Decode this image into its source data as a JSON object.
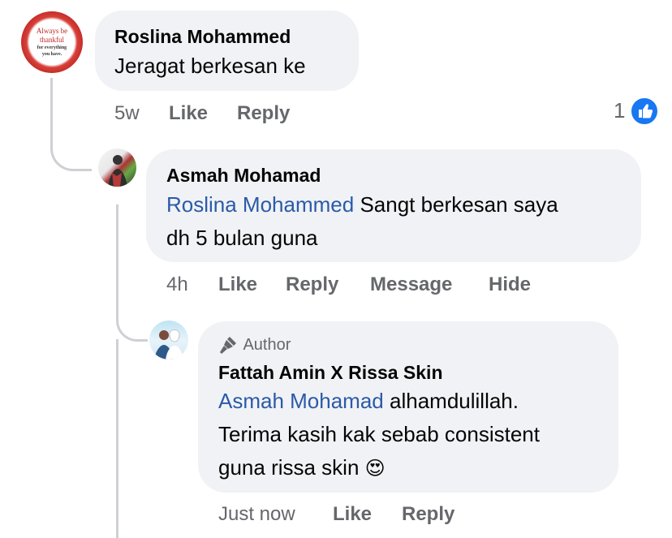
{
  "comments": [
    {
      "author": "Roslina Mohammed",
      "text": "Jeragat berkesan ke",
      "time": "5w",
      "actions": [
        "Like",
        "Reply"
      ],
      "reaction_count": "1",
      "avatar_text": {
        "line1": "Always be",
        "line2": "thankful",
        "line3": "for everything",
        "line4": "you have."
      }
    },
    {
      "author": "Asmah Mohamad",
      "mention": "Roslina Mohammed",
      "text_line1": "Sangt berkesan saya",
      "text_line2": "dh 5 bulan guna",
      "time": "4h",
      "actions": [
        "Like",
        "Reply",
        "Message",
        "Hide"
      ]
    },
    {
      "badge": "Author",
      "author": "Fattah Amin X Rissa Skin",
      "mention": "Asmah Mohamad",
      "text_line1": "alhamdulillah.",
      "text_line2": "Terima kasih kak sebab consistent",
      "text_line3": "guna rissa skin",
      "emoji": "😍",
      "time": "Just now",
      "actions": [
        "Like",
        "Reply"
      ]
    }
  ],
  "colors": {
    "bubble": "#f0f2f5",
    "mention": "#2b5aa8",
    "like_badge": "#1877f2",
    "meta_text": "#65676b",
    "thread_line": "#ced0d4"
  }
}
